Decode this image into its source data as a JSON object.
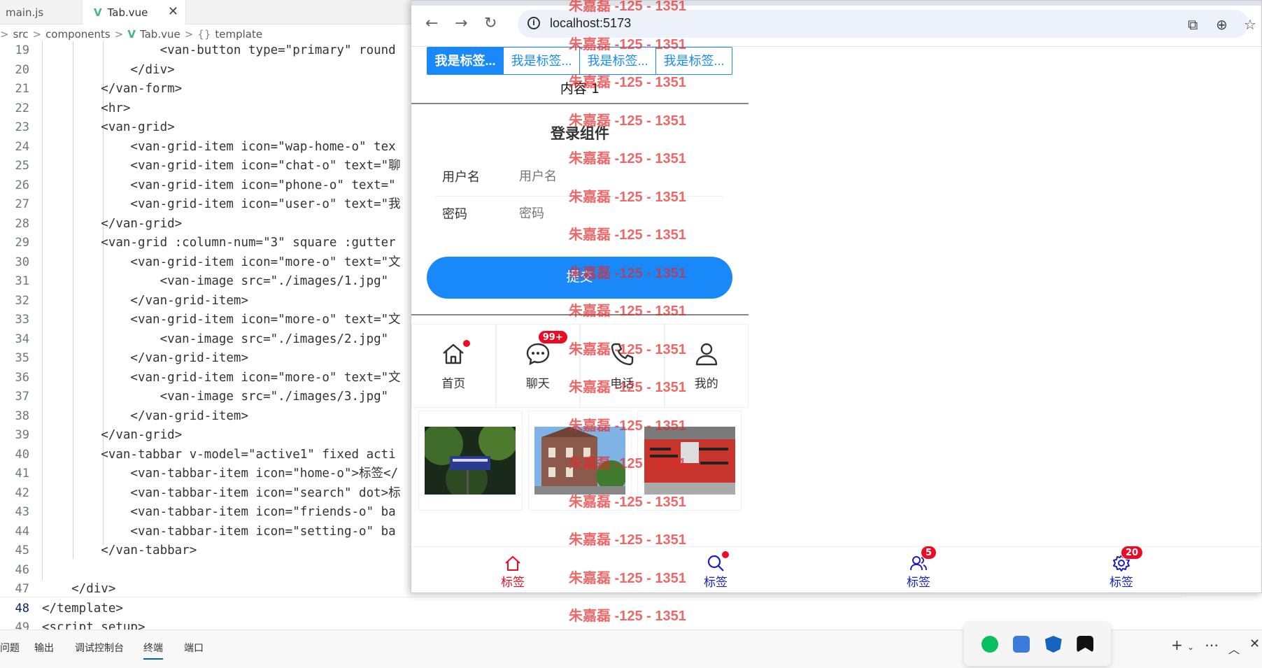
{
  "editor": {
    "tabs": [
      {
        "label": "main.js"
      },
      {
        "label": "Tab.vue",
        "close": "✕"
      }
    ],
    "breadcrumb": [
      "src",
      "components",
      "Tab.vue",
      "template"
    ],
    "lines": [
      {
        "n": "19",
        "t": "                <van-button type=\"primary\" round"
      },
      {
        "n": "20",
        "t": "            </div>"
      },
      {
        "n": "21",
        "t": "        </van-form>"
      },
      {
        "n": "22",
        "t": "        <hr>"
      },
      {
        "n": "23",
        "t": "        <van-grid>"
      },
      {
        "n": "24",
        "t": "            <van-grid-item icon=\"wap-home-o\" tex"
      },
      {
        "n": "25",
        "t": "            <van-grid-item icon=\"chat-o\" text=\"聊"
      },
      {
        "n": "26",
        "t": "            <van-grid-item icon=\"phone-o\" text=\""
      },
      {
        "n": "27",
        "t": "            <van-grid-item icon=\"user-o\" text=\"我"
      },
      {
        "n": "28",
        "t": "        </van-grid>"
      },
      {
        "n": "29",
        "t": "        <van-grid :column-num=\"3\" square :gutter"
      },
      {
        "n": "30",
        "t": "            <van-grid-item icon=\"more-o\" text=\"文"
      },
      {
        "n": "31",
        "t": "                <van-image src=\"./images/1.jpg\""
      },
      {
        "n": "32",
        "t": "            </van-grid-item>"
      },
      {
        "n": "33",
        "t": "            <van-grid-item icon=\"more-o\" text=\"文"
      },
      {
        "n": "34",
        "t": "                <van-image src=\"./images/2.jpg\""
      },
      {
        "n": "35",
        "t": "            </van-grid-item>"
      },
      {
        "n": "36",
        "t": "            <van-grid-item icon=\"more-o\" text=\"文"
      },
      {
        "n": "37",
        "t": "                <van-image src=\"./images/3.jpg\""
      },
      {
        "n": "38",
        "t": "            </van-grid-item>"
      },
      {
        "n": "39",
        "t": "        </van-grid>"
      },
      {
        "n": "40",
        "t": "        <van-tabbar v-model=\"active1\" fixed acti"
      },
      {
        "n": "41",
        "t": "            <van-tabbar-item icon=\"home-o\">标签</"
      },
      {
        "n": "42",
        "t": "            <van-tabbar-item icon=\"search\" dot>标"
      },
      {
        "n": "43",
        "t": "            <van-tabbar-item icon=\"friends-o\" ba"
      },
      {
        "n": "44",
        "t": "            <van-tabbar-item icon=\"setting-o\" ba"
      },
      {
        "n": "45",
        "t": "        </van-tabbar>"
      },
      {
        "n": "46",
        "t": ""
      },
      {
        "n": "47",
        "t": "    </div>"
      },
      {
        "n": "48",
        "t": "</template>"
      },
      {
        "n": "49",
        "t": "<script setup>"
      }
    ],
    "active_line": "48",
    "panel_tabs": [
      "问题",
      "输出",
      "调试控制台",
      "终端",
      "端口"
    ],
    "active_panel": "终端"
  },
  "browser": {
    "url": "localhost:5173",
    "tabs": [
      "我是标签...",
      "我是标签...",
      "我是标签...",
      "我是标签..."
    ],
    "content": "内容 1",
    "form_title": "登录组件",
    "fields": [
      {
        "label": "用户名",
        "placeholder": "用户名"
      },
      {
        "label": "密码",
        "placeholder": "密码"
      }
    ],
    "submit": "提交",
    "grid": [
      {
        "icon": "home-icon",
        "label": "首页",
        "dot": true
      },
      {
        "icon": "chat-icon",
        "label": "聊天",
        "badge": "99+"
      },
      {
        "icon": "phone-icon",
        "label": "电话"
      },
      {
        "icon": "user-icon",
        "label": "我的"
      }
    ],
    "tabbar": [
      {
        "icon": "home-icon",
        "label": "标签",
        "active": true
      },
      {
        "icon": "search-icon",
        "label": "标签",
        "dot": true
      },
      {
        "icon": "friends-icon",
        "label": "标签",
        "badge": "5"
      },
      {
        "icon": "setting-icon",
        "label": "标签",
        "badge": "20"
      }
    ],
    "colors": {
      "primary": "#1989fa",
      "danger": "#ee0a24",
      "tabbar_active": "#ee0a24",
      "tabbar_inactive": "#1d1dbf"
    }
  },
  "watermark": "朱嘉磊 -125 - 1351"
}
